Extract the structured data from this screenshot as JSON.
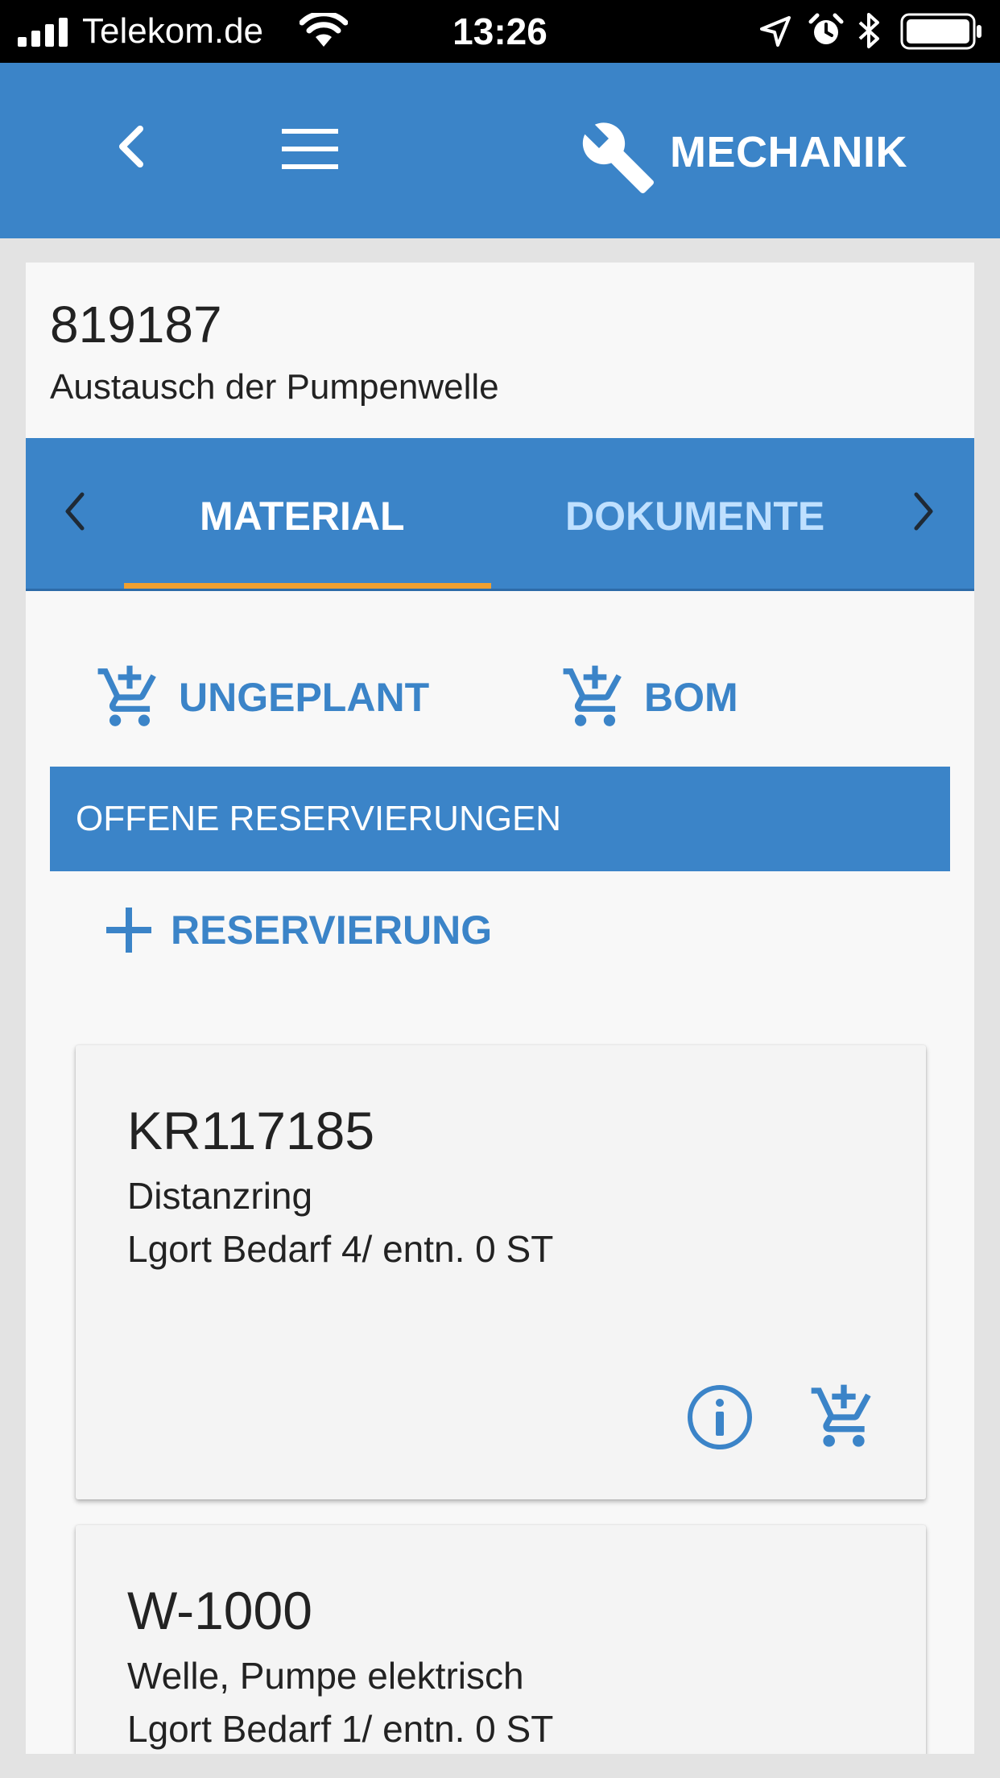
{
  "status_bar": {
    "carrier": "Telekom.de",
    "time": "13:26",
    "icons": [
      "signal-icon",
      "wifi-icon",
      "location-icon",
      "alarm-icon",
      "bluetooth-icon",
      "battery-icon"
    ]
  },
  "app_bar": {
    "title": "MECHANIK",
    "icons": [
      "back-icon",
      "menu-icon",
      "wrench-icon"
    ]
  },
  "order": {
    "number": "819187",
    "description": "Austausch der Pumpenwelle"
  },
  "tabs": {
    "items": [
      {
        "label": "MATERIAL",
        "active": true
      },
      {
        "label": "DOKUMENTE",
        "active": false
      }
    ]
  },
  "actions": {
    "unplanned_label": "UNGEPLANT",
    "bom_label": "BOM"
  },
  "section": {
    "header": "OFFENE RESERVIERUNGEN",
    "add_label": "RESERVIERUNG"
  },
  "reservations": [
    {
      "material": "KR117185",
      "name": "Distanzring",
      "quantity": "Lgort Bedarf 4/ entn. 0 ST"
    },
    {
      "material": "W-1000",
      "name": "Welle, Pumpe elektrisch",
      "quantity": "Lgort Bedarf 1/ entn. 0 ST"
    }
  ],
  "colors": {
    "primary": "#3b84c8",
    "accent": "#f0a030",
    "inactive_tab": "#bfe0ff",
    "background": "#e3e3e3",
    "card": "#f4f4f4"
  }
}
